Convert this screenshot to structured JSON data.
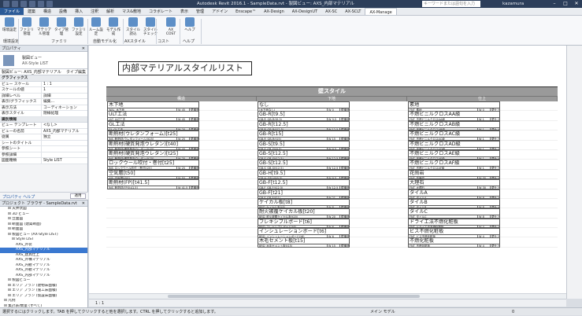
{
  "titlebar": {
    "title": "Autodesk Revit 2016.1 - SampleData.rvt - 製図ビュー: AXS_内部マテリアル",
    "search_placeholder": "キーワードまたは語句を入力",
    "user": "kazamura"
  },
  "tabs": [
    "ファイル",
    "建築",
    "構造",
    "設備",
    "挿入",
    "注釈",
    "解析",
    "マス&敷地",
    "コラボレート",
    "表示",
    "管理",
    "アドイン",
    "Enscape™",
    "AX-Design",
    "AX-DesignUT",
    "AX-SC",
    "AX-SCLT",
    "AX-Manage"
  ],
  "active_tab": "AX-Manage",
  "ribbon": {
    "buttons": [
      "環境設定",
      "ファミリ管理",
      "マテリアル管理",
      "タイプ管理",
      "ファミリ設定",
      "ルーム設定",
      "モデル作成",
      "スタイル読込",
      "スタイルチェック",
      "AX COST",
      "ヘルプ"
    ],
    "groups": [
      "環境設定",
      "ファミリ",
      "自動モデル化",
      "AXスタイル",
      "コスト",
      "ヘルプ"
    ]
  },
  "properties": {
    "header": "プロパティ",
    "type_name": "製図ビュー",
    "type_sub": "AX-Style LIST",
    "instance": "製図ビュー: AXS_内部マテリアル",
    "edit_type": "タイプ編集",
    "rows": [
      {
        "cat": "グラフィックス"
      },
      {
        "k": "ビュー スケール",
        "v": "1 : 1"
      },
      {
        "k": "スケールの値",
        "v": "1"
      },
      {
        "k": "詳細レベル",
        "v": "詳細"
      },
      {
        "k": "表示/グラフィックス",
        "v": "編集..."
      },
      {
        "k": "表示方法",
        "v": "コーディネーション"
      },
      {
        "k": "表示スタイル",
        "v": "隠線処理"
      },
      {
        "cat": "識別情報"
      },
      {
        "k": "ビュー テンプレート",
        "v": "<なし>"
      },
      {
        "k": "ビューの名前",
        "v": "AXS_内部マテリアル"
      },
      {
        "k": "従属",
        "v": "独立"
      },
      {
        "k": "シートのタイトル",
        "v": ""
      },
      {
        "k": "参照シート",
        "v": ""
      },
      {
        "k": "参照詳細",
        "v": ""
      },
      {
        "k": "図面種類",
        "v": "Style LIST"
      }
    ],
    "help_link": "プロパティ ヘルプ",
    "apply": "適用"
  },
  "browser": {
    "header": "プロジェクト ブラウザ - SampleData.rvt",
    "items": [
      {
        "t": "天井伏図",
        "lv": 2
      },
      {
        "t": "3D ビュー",
        "lv": 2
      },
      {
        "t": "立面図",
        "lv": 2
      },
      {
        "t": "断面図 (建築断面)",
        "lv": 2
      },
      {
        "t": "断面図",
        "lv": 2
      },
      {
        "t": "製図ビュー (AX-Style LIST)",
        "lv": 2
      },
      {
        "t": "Style LIST",
        "lv": 3
      },
      {
        "t": "AXS_外装",
        "lv": 4
      },
      {
        "t": "AXS_内部マテリアル",
        "lv": 4,
        "sel": true
      },
      {
        "t": "AXS_建具仕上",
        "lv": 4
      },
      {
        "t": "AXS_外構マテリアル",
        "lv": 4
      },
      {
        "t": "AXS_内観マテリアル",
        "lv": 4
      },
      {
        "t": "AXS_外観マテリアル",
        "lv": 4
      },
      {
        "t": "AXS_内部マテリアル",
        "lv": 4
      },
      {
        "t": "製図ビュー",
        "lv": 2
      },
      {
        "t": "エリア プラン (建物床面積)",
        "lv": 2
      },
      {
        "t": "エリア プラン (施工床面積)",
        "lv": 2
      },
      {
        "t": "エリア プラン (仮設床面積)",
        "lv": 2
      },
      {
        "t": "凡例",
        "lv": 1
      },
      {
        "t": "集計表/数量 (すべて)",
        "lv": 1
      }
    ]
  },
  "sheet": {
    "title": "内部マテリアルスタイルリスト",
    "table_title": "壁スタイル",
    "columns": [
      "構造",
      "下地",
      "仕上"
    ],
    "rows": [
      [
        {
          "b": "木下地",
          "s": "WAL_木下地",
          "c2": "W 45",
          "c3": "壁構造"
        },
        {
          "b": "なし",
          "s": "(木下地なし)",
          "c2": "W 0",
          "c3": "壁構造"
        },
        {
          "b": "素地",
          "s": "FNT_素地",
          "c2": "W 0",
          "c3": "壁仕上"
        }
      ],
      [
        {
          "b": "ULT工法",
          "s": "ULT_ULT工法",
          "c2": "W 45",
          "c3": "壁構造"
        },
        {
          "b": "GB-R[t9.5]",
          "s": "GB-R_GB-R(t9.5)",
          "c2": "W 9.5",
          "c3": "壁構造"
        },
        {
          "b": "不燃ビニルクロスAA級",
          "s": "FNT_不燃ビニルクロスAA級",
          "c2": "W 1",
          "c3": "壁仕上"
        }
      ],
      [
        {
          "b": "GL工法",
          "s": "GL_GL工法",
          "c2": "W 20",
          "c3": "壁構造"
        },
        {
          "b": "GB-R[t12.5]",
          "s": "GB-R_GB-R(t12.5)",
          "c2": "W 12.5",
          "c3": "壁構造"
        },
        {
          "b": "不燃ビニルクロスAB級",
          "s": "FNT_不燃ビニルクロスAB級",
          "c2": "W 1",
          "c3": "壁仕上"
        }
      ],
      [
        {
          "b": "断熱材(ウレタンフォーム)[t25]",
          "s": "INS_断熱材(ウレタンフォーム)[t25]",
          "c2": "W 25",
          "c3": "壁構造"
        },
        {
          "b": "GB-R[t15]",
          "s": "GB-R_GB-R(t15)",
          "c2": "W 15",
          "c3": "壁構造"
        },
        {
          "b": "不燃ビニルクロスAC級",
          "s": "FNT_不燃ビニルクロスAC級",
          "c2": "W 1",
          "c3": "壁仕上"
        }
      ],
      [
        {
          "b": "断熱材(硬質発泡ウレタン)[t40]",
          "s": "INS_断熱材(硬質発泡ウレタン)[t40]",
          "c2": "W 40",
          "c3": "壁構造"
        },
        {
          "b": "GB-S[t9.5]",
          "s": "GB-S_GB-S(t9.5)",
          "c2": "W 9.5",
          "c3": "壁構造"
        },
        {
          "b": "不燃ビニルクロスAD級",
          "s": "FNT_不燃ビニルクロスAD級",
          "c2": "W 1",
          "c3": "壁仕上"
        }
      ],
      [
        {
          "b": "断熱材(硬質発泡ウレタン)[t25]",
          "s": "INS_断熱材(硬質発泡ウレタン)[t25]",
          "c2": "W 25",
          "c3": "壁構造"
        },
        {
          "b": "GB-S[t12.5]",
          "s": "GB-S_GB-S(t12.5)",
          "c2": "W 12.5",
          "c3": "壁構造"
        },
        {
          "b": "不燃ビニルクロスAE級",
          "s": "FNT_不燃ビニルクロスAE級",
          "c2": "W 1",
          "c3": "壁仕上"
        }
      ],
      [
        {
          "b": "ロックウール吹付・巻付[t25]",
          "s": "INS_ロックウール吹付・巻付[t25]",
          "c2": "W 25",
          "c3": "壁構造"
        },
        {
          "b": "GB-S[t12.5]",
          "s": "GB-S_GB-S(t12.5)",
          "c2": "W 12.5",
          "c3": "壁構造"
        },
        {
          "b": "不燃ビニルクロスAF級",
          "s": "FNT_不燃ビニルクロスAF級",
          "c2": "W 1",
          "c3": "壁仕上"
        }
      ],
      [
        {
          "b": "空気層[t50]",
          "s": "AIR_空気層[t50]",
          "c2": "W 50",
          "c3": "壁構造"
        },
        {
          "b": "GB-H[t9.5]",
          "s": "GB-H_GB-H(t9.5)",
          "c2": "W 9.5",
          "c3": "壁構造"
        },
        {
          "b": "花崗岩",
          "s": "FNT_花崗岩",
          "c2": "W 30",
          "c3": "壁仕上"
        }
      ],
      [
        {
          "b": "断熱材(FP)[t41.5]",
          "s": "INS_断熱材(FP)[t41.5]",
          "c2": "W 41.5",
          "c3": "壁構造"
        },
        {
          "b": "GB-F[t12.5]",
          "s": "GB-F_GB-F(t12.5)",
          "c2": "W 12.5",
          "c3": "壁構造"
        },
        {
          "b": "大理石",
          "s": "FNT_大理石",
          "c2": "W 30",
          "c3": "壁仕上"
        }
      ],
      [
        null,
        {
          "b": "GB-F[t21]",
          "s": "GB-F_GB-F(t21)",
          "c2": "W 21",
          "c3": "壁構造"
        },
        {
          "b": "タイルA",
          "s": "FNT_タイルA",
          "c2": "W 8",
          "c3": "壁仕上"
        }
      ],
      [
        null,
        {
          "b": "ケイカル板[t8]",
          "s": "BRD_ケイカル板(t8)",
          "c2": "W 8",
          "c3": "壁構造"
        },
        {
          "b": "タイルB",
          "s": "FNT_タイルB",
          "c2": "W 8",
          "c3": "壁仕上"
        }
      ],
      [
        null,
        {
          "b": "耐火被覆ケイカル板[t20]",
          "s": "BRD_耐火被覆ケイカル板(t20)",
          "c2": "W 20",
          "c3": "壁構造"
        },
        {
          "b": "タイルC",
          "s": "FNT_タイルC",
          "c2": "W 8",
          "c3": "壁仕上"
        }
      ],
      [
        null,
        {
          "b": "フレキシブルボード[t6]",
          "s": "BRD_フレキシブルボード(t6)",
          "c2": "W 6",
          "c3": "壁構造"
        },
        {
          "b": "ドライ工法不燃化粧板",
          "s": "FNT_ドライ工法不燃化粧板",
          "c2": "W 4",
          "c3": "壁仕上"
        }
      ],
      [
        null,
        {
          "b": "インシュレーションボード[t6]",
          "s": "BRD_インシュレーションボード(t6)",
          "c2": "W 6",
          "c3": "壁構造"
        },
        {
          "b": "ビス不燃化粧板",
          "s": "FNT_ビス不燃化粧板",
          "c2": "W 4",
          "c3": "壁仕上"
        }
      ],
      [
        null,
        {
          "b": "木毛セメント板[t15]",
          "s": "BRD_木毛セメント板(t15)",
          "c2": "W 15",
          "c3": "壁構造"
        },
        {
          "b": "不燃化粧板",
          "s": "FNT_不燃化粧板",
          "c2": "W 4",
          "c3": "壁仕上"
        }
      ]
    ]
  },
  "view_control": {
    "scale": "1 : 1"
  },
  "status": {
    "text": "選択するにはクリックします。TAB を押してクリックすると他を選択します。CTRL を押してクリックすると追加します。",
    "model": "メイン モデル",
    "zoom": "0"
  }
}
